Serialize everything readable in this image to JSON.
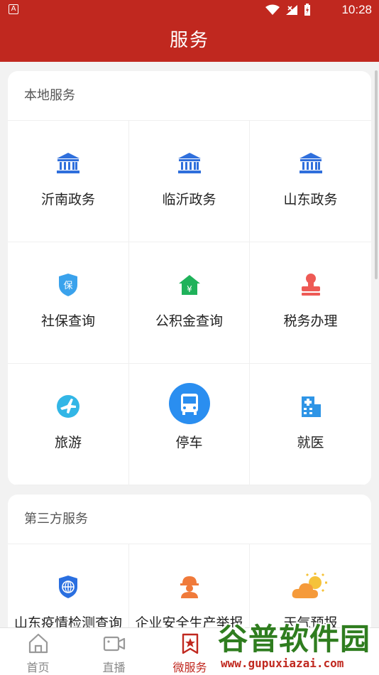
{
  "status_bar": {
    "app_icon_letter": "A",
    "time": "10:28"
  },
  "header": {
    "title": "服务"
  },
  "sections": [
    {
      "title": "本地服务",
      "items": [
        {
          "label": "沂南政务",
          "icon": "government-building-icon",
          "color": "#2f6fdc"
        },
        {
          "label": "临沂政务",
          "icon": "government-building-icon",
          "color": "#2f6fdc"
        },
        {
          "label": "山东政务",
          "icon": "government-building-icon",
          "color": "#2f6fdc"
        },
        {
          "label": "社保查询",
          "icon": "social-security-shield-icon",
          "color": "#3aa2ec"
        },
        {
          "label": "公积金查询",
          "icon": "housing-fund-house-icon",
          "color": "#1fb25a"
        },
        {
          "label": "税务办理",
          "icon": "tax-stamp-icon",
          "color": "#ee5a55"
        },
        {
          "label": "旅游",
          "icon": "travel-airplane-globe-icon",
          "color": "#32b6e6"
        },
        {
          "label": "停车",
          "icon": "bus-icon",
          "color": "#2a8ef0"
        },
        {
          "label": "就医",
          "icon": "hospital-building-icon",
          "color": "#2f95e6"
        }
      ]
    },
    {
      "title": "第三方服务",
      "items": [
        {
          "label": "山东疫情检测查询",
          "icon": "epidemic-shield-globe-icon",
          "color": "#2a6fe0"
        },
        {
          "label": "企业安全生产举报",
          "icon": "worker-helmet-icon",
          "color": "#f07a3a"
        },
        {
          "label": "天气预报",
          "icon": "weather-sun-cloud-icon",
          "color": "#f5a23a"
        }
      ]
    }
  ],
  "tabbar": {
    "tabs": [
      {
        "label": "首页",
        "icon": "home-icon",
        "active": false
      },
      {
        "label": "直播",
        "icon": "video-camera-icon",
        "active": false
      },
      {
        "label": "微服务",
        "icon": "service-bookmark-star-icon",
        "active": true
      }
    ]
  },
  "watermark": {
    "text": "谷普软件园",
    "url": "www.gupuxiazai.com"
  },
  "colors": {
    "brand_red": "#c0281f",
    "background": "#f2f2f2"
  }
}
